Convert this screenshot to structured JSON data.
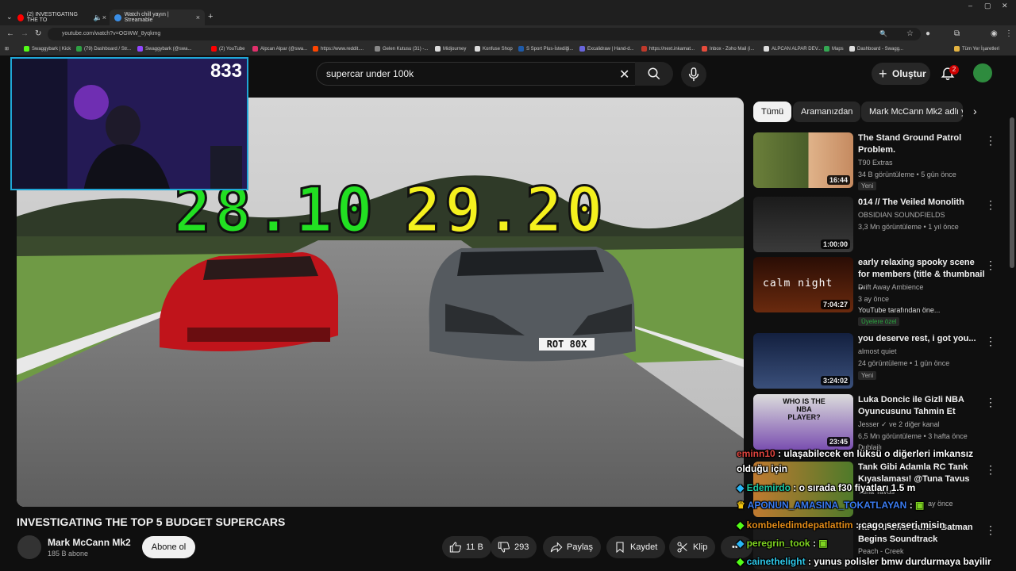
{
  "browser": {
    "tabs": [
      {
        "title": "(2) INVESTIGATING THE TO",
        "color": "#ff0000"
      },
      {
        "title": "Watch chill yayın | Streamable",
        "color": "#3a8ee6"
      }
    ],
    "url": "youtube.com/watch?v=OGWW_8yqkmg",
    "bookmarks": [
      {
        "label": "Swaggybark | Kick",
        "color": "#53fc18"
      },
      {
        "label": "(79) Dashboard / Str...",
        "color": "#2ea043"
      },
      {
        "label": "Swaggybark (@swa...",
        "color": "#9146ff"
      },
      {
        "label": "(2) YouTube",
        "color": "#ff0000"
      },
      {
        "label": "Alpcan Alpar (@swa...",
        "color": "#e1306c"
      },
      {
        "label": "https://www.reddit....",
        "color": "#ff4500"
      },
      {
        "label": "Gelen Kutusu (31) -...",
        "color": "#888888"
      },
      {
        "label": "Midjourney",
        "color": "#dddddd"
      },
      {
        "label": "Konfuse Shop",
        "color": "#dddddd"
      },
      {
        "label": "S Sport Plus-İstediği...",
        "color": "#1e5aa8"
      },
      {
        "label": "Excalidraw | Hand-d...",
        "color": "#6965db"
      },
      {
        "label": "https://next.inkamat...",
        "color": "#c0392b"
      },
      {
        "label": "Inbox - Zoho Mail (i...",
        "color": "#e74c3c"
      },
      {
        "label": "ALPCAN ALPAR DEV...",
        "color": "#dddddd"
      },
      {
        "label": "Maps",
        "color": "#34a853"
      },
      {
        "label": "Dashboard - Swagg...",
        "color": "#dddddd"
      }
    ],
    "all_bookmarks": "Tüm Yer İşaretleri"
  },
  "header": {
    "search_query": "supercar under 100k",
    "create_label": "Oluştur",
    "notifications": "2"
  },
  "webcam": {
    "viewers": "833"
  },
  "player": {
    "timer_left": "28.10",
    "timer_right": "29.20",
    "plate": "ROT 80X"
  },
  "video": {
    "title": "INVESTIGATING THE TOP 5 BUDGET SUPERCARS",
    "channel": "Mark McCann Mk2",
    "subscribers": "185 B abone",
    "subscribe_label": "Abone ol",
    "likes": "11 B",
    "dislikes": "293",
    "share_label": "Paylaş",
    "save_label": "Kaydet",
    "clip_label": "Klip"
  },
  "chips": [
    {
      "label": "Tümü"
    },
    {
      "label": "Aramanızdan"
    },
    {
      "label": "Mark McCann Mk2 adlı y"
    }
  ],
  "recommendations": [
    {
      "title": "The Stand Ground Patrol Problem.",
      "channel": "T90 Extras",
      "meta": "34 B görüntüleme • 5 gün önce",
      "badge": "Yeni",
      "duration": "16:44"
    },
    {
      "title": "014 // The Veiled Monolith",
      "channel": "OBSIDIAN SOUNDFIELDS",
      "meta": "3,3 Mn görüntüleme • 1 yıl önce",
      "badge": "",
      "duration": "1:00:00"
    },
    {
      "title": "early relaxing spooky scene for members (title & thumbnail ...",
      "channel": "Drift Away Ambience",
      "meta": "3 ay önce",
      "extra": "YouTube tarafından öne...",
      "badge": "Üyelere özel",
      "duration": "7:04:27",
      "thumb_text": "calm night"
    },
    {
      "title": "you deserve rest, i got you...",
      "channel": "almost quiet",
      "meta": "24 görüntüleme • 1 gün önce",
      "badge": "Yeni",
      "duration": "3:24:02"
    },
    {
      "title": "Luka Doncic ile Gizli NBA Oyuncusunu Tahmin Et",
      "channel": "Jesser",
      "channel_extra": "ve 2 diğer kanal",
      "meta": "6,5 Mn görüntüleme • 3 hafta önce",
      "badge": "Dublajlı",
      "duration": "23:45",
      "thumb_text": "WHO IS THE NBA PLAYER?"
    },
    {
      "title": "Tank Gibi Adamla RC Tank Kıyaslaması! @Tuna Tavus",
      "channel": "Tuna Tavus",
      "meta": "ay önce",
      "badge": "",
      "duration": ""
    },
    {
      "title": "Ra's Al Ghul Suite - Batman Begins Soundtrack",
      "channel": "Peach - Creek",
      "meta": "",
      "badge": "",
      "duration": ""
    }
  ],
  "chat": [
    {
      "user": "eminn10",
      "sep": ":",
      "message": "ulaşabilecek en lüksü o diğerleri imkansız",
      "color": "#e0443e"
    },
    {
      "user": "",
      "sep": "",
      "message": "olduğu için",
      "color": "#ffffff"
    },
    {
      "user": "Edemirdo",
      "sep": ":",
      "message": "o sırada f30 fiyatları 1.5 m",
      "color": "#1ec8a0"
    },
    {
      "user": "APONUN_AMASINA_TOKATLAYAN",
      "sep": ":",
      "message": "",
      "color": "#3a7bf0"
    },
    {
      "user": "kombeledimdepatlattim",
      "sep": ":",
      "message": "cago serseri misin",
      "color": "#e08a18"
    },
    {
      "user": "peregrin_took",
      "sep": ":",
      "message": "",
      "color": "#7ed321"
    },
    {
      "user": "cainethelight",
      "sep": ":",
      "message": "yunus polisler bmw durdurmaya bayilir",
      "color": "#2ec7e8"
    }
  ]
}
